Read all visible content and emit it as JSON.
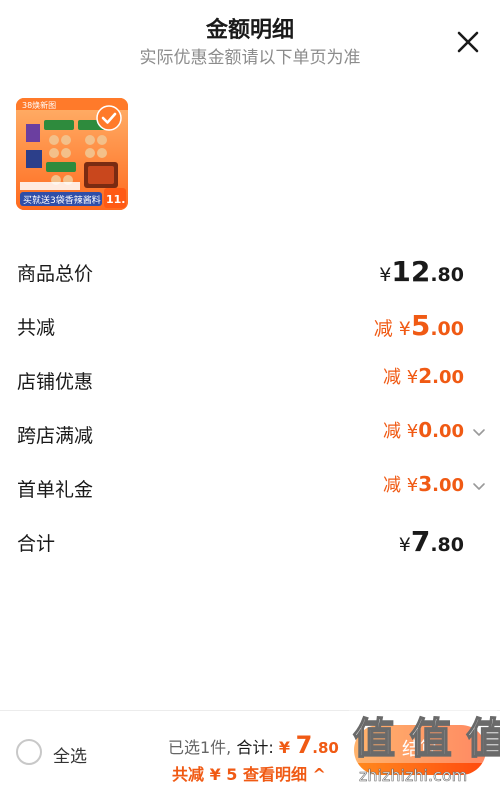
{
  "header": {
    "title": "金额明细",
    "subtitle": "实际优惠金额请以下单页为准",
    "close_icon": "close-icon"
  },
  "product": {
    "badge": "38焕新图",
    "thumb_caption": "买就送3袋香辣酱料",
    "thumb_price": "11.",
    "selected": true
  },
  "rows": [
    {
      "label": "商品总价",
      "prefix": "¥",
      "int": "12",
      "dec": ".80",
      "color": "#1a1a1a",
      "chevron": false
    },
    {
      "label": "共减",
      "prefix": "减 ¥",
      "int": "5",
      "dec": ".00",
      "color": "#f05a14",
      "chevron": false
    },
    {
      "label": "店铺优惠",
      "prefix": "减 ¥",
      "int": "2",
      "dec": ".00",
      "color": "#f05a14",
      "chevron": false
    },
    {
      "label": "跨店满减",
      "prefix": "减 ¥",
      "int": "0",
      "dec": ".00",
      "color": "#f05a14",
      "chevron": true
    },
    {
      "label": "首单礼金",
      "prefix": "减 ¥",
      "int": "3",
      "dec": ".00",
      "color": "#f05a14",
      "chevron": true
    },
    {
      "label": "合计",
      "prefix": "¥",
      "int": "7",
      "dec": ".80",
      "color": "#1a1a1a",
      "chevron": false
    }
  ],
  "footer": {
    "select_all_label": "全选",
    "selected_count_text": "已选1件,",
    "total_label": "合计:",
    "total_yen": "¥",
    "total_int": "7",
    "total_dec": ".80",
    "detail_link": "共减 ¥ 5  查看明细 ^",
    "checkout_label": "结算",
    "watermark_text": "值 值 值",
    "watermark_url": "zhizhizhi.com"
  },
  "colors": {
    "accent": "#f05a14",
    "checkout_gradient_start": "#ff8a1e",
    "checkout_gradient_end": "#ff4a0f",
    "text": "#1a1a1a",
    "muted": "#8c8c8c"
  }
}
